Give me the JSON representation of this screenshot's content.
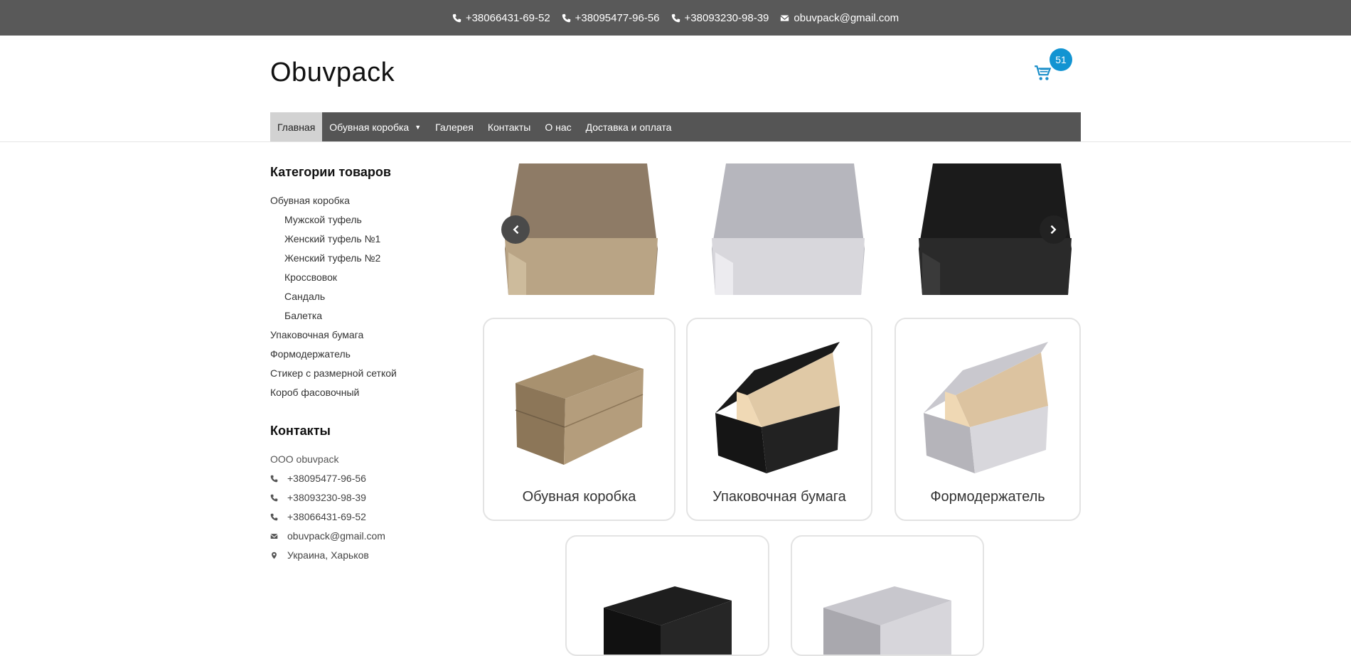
{
  "topbar": {
    "phones": [
      "+38066431-69-52",
      "+38095477-96-56",
      "+38093230-98-39"
    ],
    "email": "obuvpack@gmail.com"
  },
  "header": {
    "logo": "Obuvpack",
    "cart_count": "51"
  },
  "nav": {
    "items": [
      {
        "label": "Главная",
        "active": true
      },
      {
        "label": "Обувная коробка",
        "has_caret": true
      },
      {
        "label": "Галерея"
      },
      {
        "label": "Контакты"
      },
      {
        "label": "О нас"
      },
      {
        "label": "Доставка и оплата"
      }
    ]
  },
  "sidebar": {
    "categories_title": "Категории товаров",
    "categories": [
      {
        "label": "Обувная коробка",
        "children": [
          "Мужской туфель",
          "Женский туфель №1",
          "Женский туфель №2",
          "Кроссвовок",
          "Сандаль",
          "Балетка"
        ]
      },
      {
        "label": "Упаковочная бумага"
      },
      {
        "label": "Формодержатель"
      },
      {
        "label": "Стикер с размерной сеткой"
      },
      {
        "label": "Короб фасовочный"
      }
    ],
    "contacts_title": "Контакты",
    "org": "ООО obuvpack",
    "phones": [
      "+38095477-96-56",
      "+38093230-98-39",
      "+38066431-69-52"
    ],
    "email": "obuvpack@gmail.com",
    "address": "Украина, Харьков"
  },
  "category_cards": [
    {
      "label": "Обувная коробка"
    },
    {
      "label": "Упаковочная бумага"
    },
    {
      "label": "Формодержатель"
    },
    {
      "label": ""
    },
    {
      "label": ""
    }
  ],
  "colors": {
    "topbar_bg": "#595959",
    "nav_bg": "#555555",
    "accent": "#1294d2"
  }
}
